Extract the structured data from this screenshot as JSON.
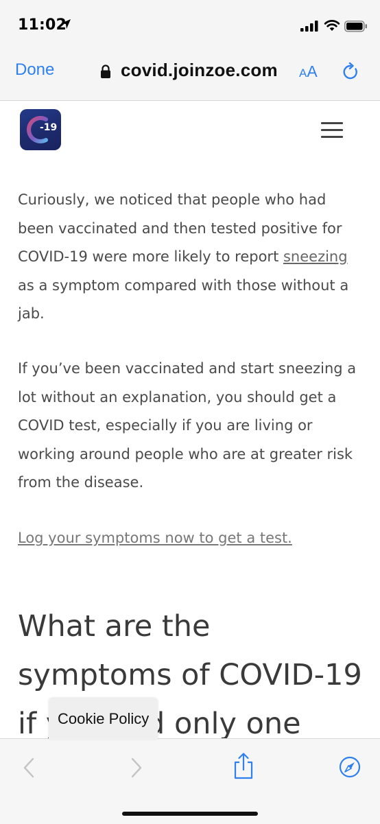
{
  "status_bar": {
    "time": "11:02",
    "icons": [
      "location-arrow-icon",
      "signal-icon",
      "wifi-icon",
      "battery-icon"
    ]
  },
  "browser": {
    "done_label": "Done",
    "url": "covid.joinzoe.com",
    "aa_small": "A",
    "aa_large": "A",
    "icons": [
      "lock-icon",
      "reload-icon"
    ],
    "accent_color": "#2f80ed"
  },
  "header": {
    "logo_text": "-19",
    "logo_colors": [
      "#243a8a",
      "#d04a7a",
      "#5fb0e8"
    ],
    "menu_icon": "hamburger-icon"
  },
  "article": {
    "p1_before": "Curiously, we noticed that people who had been vaccinated and then tested positive for COVID-19 were more likely to report ",
    "p1_link": "sneezing",
    "p1_after": " as a symptom compared with those without a jab.",
    "p2": "If you’ve been vaccinated and start sneezing a lot without an explanation, you should get a COVID test, especially if you are living or working around people who are at greater risk from the disease.",
    "cta_link": "Log your symptoms now to get a test.",
    "heading": "What are the symptoms of COVID-19 if you had only one"
  },
  "cookie": {
    "label": "Cookie Policy"
  },
  "toolbar": {
    "icons": [
      "back-chevron-icon",
      "forward-chevron-icon",
      "share-icon",
      "compass-icon"
    ]
  }
}
